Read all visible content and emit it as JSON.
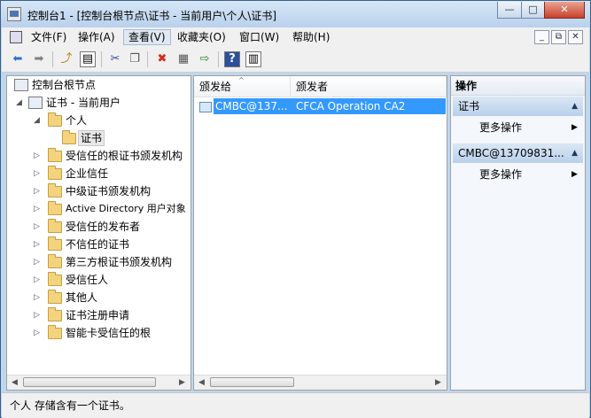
{
  "window": {
    "title": "控制台1 - [控制台根节点\\证书 - 当前用户\\个人\\证书]",
    "btn_minimize": "—",
    "btn_maximize": "□",
    "btn_close": "✕"
  },
  "menu": {
    "items": [
      "文件(F)",
      "操作(A)",
      "查看(V)",
      "收藏夹(O)",
      "窗口(W)",
      "帮助(H)"
    ],
    "mdi_minimize": "_",
    "mdi_restore": "⧉",
    "mdi_close": "✕"
  },
  "toolbar": {
    "icons": [
      "back-arrow-icon",
      "forward-arrow-icon",
      "up-folder-icon",
      "show-hide-tree-icon",
      "cut-icon",
      "copy-icon",
      "delete-icon",
      "properties-icon",
      "export-icon",
      "help-icon",
      "show-hide-action-icon"
    ],
    "glyphs": {
      "back": "⬅",
      "forward": "➡",
      "up": "⤴",
      "tree": "▤",
      "cut": "✂",
      "copy": "❐",
      "delete": "✖",
      "properties": "▦",
      "export": "⇨",
      "help": "?",
      "action": "▥"
    },
    "colors": {
      "back": "#2d6fc9",
      "forward": "#7f7f7f",
      "delete": "#d42a1c",
      "help": "#2d4f9c"
    }
  },
  "tree": {
    "root": "控制台根节点",
    "cert_store": "证书 - 当前用户",
    "personal": "个人",
    "certificates": "证书",
    "folders": [
      "受信任的根证书颁发机构",
      "企业信任",
      "中级证书颁发机构",
      "Active Directory 用户对象",
      "受信任的发布者",
      "不信任的证书",
      "第三方根证书颁发机构",
      "受信任人",
      "其他人",
      "证书注册申请",
      "智能卡受信任的根"
    ]
  },
  "list": {
    "col_issued_to": "颁发给",
    "col_issued_by": "颁发者",
    "rows": [
      {
        "issued_to": "CMBC@137...",
        "issued_by": "CFCA Operation CA2"
      }
    ]
  },
  "actions": {
    "header": "操作",
    "section1_title": "证书",
    "section1_more": "更多操作",
    "section2_title": "CMBC@13709831...",
    "section2_more": "更多操作"
  },
  "scroll": {
    "left": "◀",
    "right": "▶",
    "collapse": "▲",
    "submenu": "▶"
  },
  "status": {
    "text": "个人 存储含有一个证书。"
  }
}
